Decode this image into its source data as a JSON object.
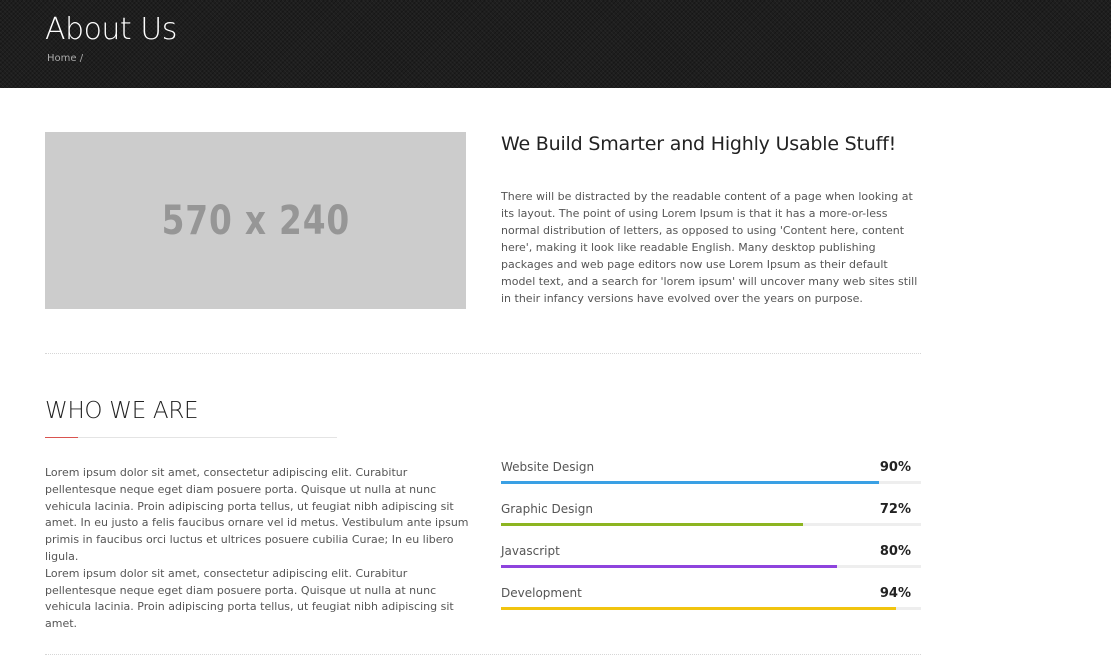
{
  "header": {
    "title": "About Us",
    "breadcrumb_home": "Home",
    "breadcrumb_separator": "/"
  },
  "intro": {
    "image_placeholder": "570 x 240",
    "heading": "We Build Smarter and Highly Usable Stuff!",
    "paragraph": "There will be distracted by the readable content of a page when looking at its layout. The point of using Lorem Ipsum is that it has a more-or-less normal distribution of letters, as opposed to using 'Content here, content here', making it look like readable English. Many desktop publishing packages and web page editors now use Lorem Ipsum as their default model text, and a search for 'lorem ipsum' will uncover many web sites still in their infancy versions have evolved over the years on purpose."
  },
  "who": {
    "title": "WHO WE ARE",
    "paragraph1": "Lorem ipsum dolor sit amet, consectetur adipiscing elit. Curabitur pellentesque neque eget diam posuere porta. Quisque ut nulla at nunc vehicula lacinia. Proin adipiscing porta tellus, ut feugiat nibh adipiscing sit amet. In eu justo a felis faucibus ornare vel id metus. Vestibulum ante ipsum primis in faucibus orci luctus et ultrices posuere cubilia Curae; In eu libero ligula.",
    "paragraph2": "Lorem ipsum dolor sit amet, consectetur adipiscing elit. Curabitur pellentesque neque eget diam posuere porta. Quisque ut nulla at nunc vehicula lacinia. Proin adipiscing porta tellus, ut feugiat nibh adipiscing sit amet."
  },
  "skills": [
    {
      "name": "Website Design",
      "percent_label": "90%",
      "value": 90,
      "color": "#3aa0e4"
    },
    {
      "name": "Graphic Design",
      "percent_label": "72%",
      "value": 72,
      "color": "#8db521"
    },
    {
      "name": "Javascript",
      "percent_label": "80%",
      "value": 80,
      "color": "#8e44dd"
    },
    {
      "name": "Development",
      "percent_label": "94%",
      "value": 94,
      "color": "#f1c40f"
    }
  ]
}
